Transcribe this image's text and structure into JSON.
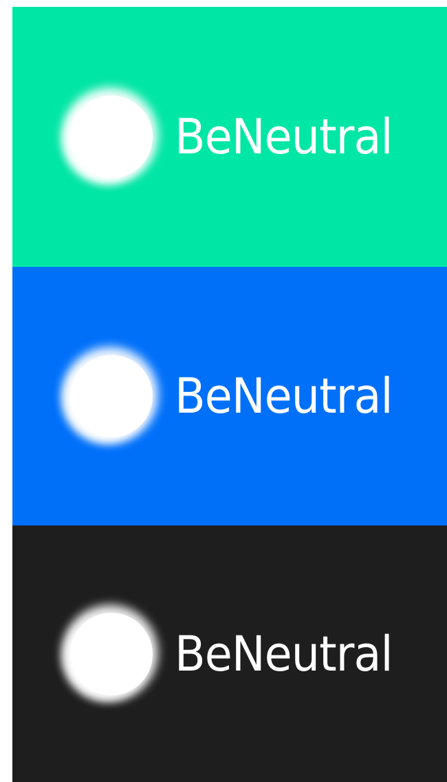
{
  "panels": [
    {
      "background": "#00E6A5",
      "wordmark": "BeNeutral"
    },
    {
      "background": "#0070F9",
      "wordmark": "BeNeutral"
    },
    {
      "background": "#1E1E1E",
      "wordmark": "BeNeutral"
    }
  ],
  "logo": {
    "mark_color": "#FFFFFF",
    "text_color": "#FFFFFF"
  }
}
